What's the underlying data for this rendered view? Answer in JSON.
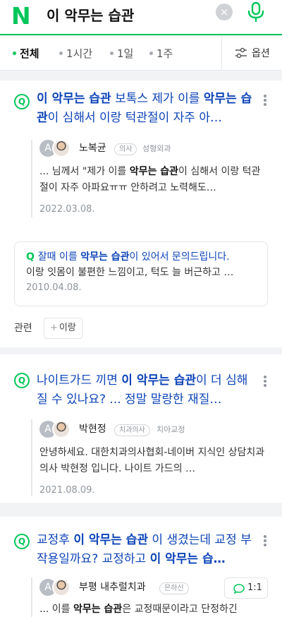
{
  "search": {
    "logo": "N",
    "query": "이 악무는 습관",
    "clear_icon": "×"
  },
  "tabs": [
    {
      "label": "전체",
      "active": true
    },
    {
      "label": "1시간",
      "active": false
    },
    {
      "label": "1일",
      "active": false
    },
    {
      "label": "1주",
      "active": false
    }
  ],
  "options_label": "옵션",
  "results": [
    {
      "title_pre": "",
      "title_hl": "이 악무는 습관",
      "title_mid": " 보톡스 제가 이를 ",
      "title_hl2": "악무는 습관",
      "title_post": "이 심해서 이랑 턱관절이 자주 아…",
      "avatar_letter": "A",
      "author": "노복균",
      "badge": "의사",
      "specialty": "성형외과",
      "snippet_pre": "... 님께서 \"제가 이를 ",
      "snippet_hl": "악무는 습관",
      "snippet_post": "이 심해서 이랑 턱관절이 자주 아파요ㅠㅠ 안하려고 노력해도…",
      "date": "2022.03.08."
    },
    {
      "title_pre": "나이트가드 끼면 ",
      "title_hl": "이 악무는 습관",
      "title_mid": "이 더 심해질 수 있나요? ... 정말 말랑한 재질…",
      "title_hl2": "",
      "title_post": "",
      "avatar_letter": "A",
      "author": "박현정",
      "badge": "치과의사",
      "specialty": "치아교정",
      "snippet_pre": "안녕하세요. 대한치과의사협회-네이버 지식인 상담치과의사 박현정 입니다. 나이트 가드의 …",
      "snippet_hl": "",
      "snippet_post": "",
      "date": "2021.08.09."
    },
    {
      "title_pre": "교정후 ",
      "title_hl": "이 악무는 습관",
      "title_mid": " 이 생겼는데 교정 부작용일까요? 교정하고 ",
      "title_hl2": "이 악무는 습…",
      "title_post": "",
      "avatar_letter": "A",
      "author": "부평 내추럴치과",
      "badge": "은하신",
      "answer_count": "1:1",
      "snippet_pre": "... 이를 ",
      "snippet_hl": "악무는 습관",
      "snippet_post": "은 교정때문이라고 단정하긴"
    }
  ],
  "related_question": {
    "title_pre": "잘때 이를 ",
    "title_hl": "악무는 습관",
    "title_post": "이 있어서 문의드립니다.",
    "snippet": "이랑 잇몸이 불편한 느낌이고, 턱도 늘 버근하고 …",
    "date": "2010.04.08."
  },
  "related_tags": {
    "label": "관련",
    "chips": [
      "이랑"
    ]
  },
  "colors": {
    "accent": "#03c75a",
    "link": "#0c43b7"
  }
}
